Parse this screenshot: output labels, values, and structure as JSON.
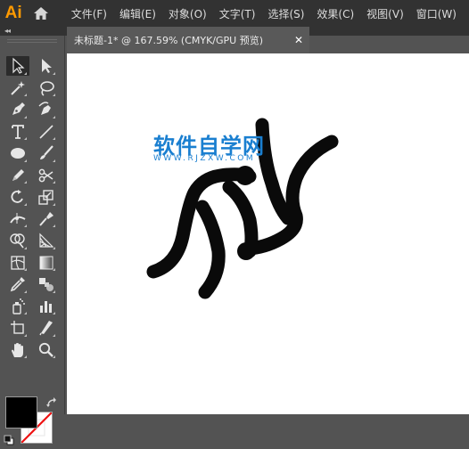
{
  "app": {
    "logo": "Ai"
  },
  "menu": {
    "items": [
      "文件(F)",
      "编辑(E)",
      "对象(O)",
      "文字(T)",
      "选择(S)",
      "效果(C)",
      "视图(V)",
      "窗口(W)"
    ]
  },
  "document_tab": {
    "title": "未标题-1* @ 167.59% (CMYK/GPU 预览)",
    "close": "✕"
  },
  "panel_collapse": "◂◂",
  "tools": [
    "selection-tool",
    "direct-selection-tool",
    "magic-wand-tool",
    "lasso-tool",
    "pen-tool",
    "curvature-tool",
    "type-tool",
    "line-segment-tool",
    "ellipse-tool",
    "paintbrush-tool",
    "pencil-tool",
    "scissors-tool",
    "rotate-tool",
    "scale-tool",
    "width-tool",
    "puppet-warp-tool",
    "shape-builder-tool",
    "perspective-grid-tool",
    "mesh-tool",
    "gradient-tool",
    "eyedropper-tool",
    "blend-tool",
    "symbol-sprayer-tool",
    "column-graph-tool",
    "artboard-tool",
    "slice-tool",
    "hand-tool",
    "zoom-tool"
  ],
  "colors": {
    "fill": "#000000",
    "stroke": "none",
    "accent": "#ff9a00",
    "watermark": "#1a7fd0"
  },
  "watermark": {
    "title": "软件自学网",
    "url": "WWW.RJZXW.COM"
  }
}
